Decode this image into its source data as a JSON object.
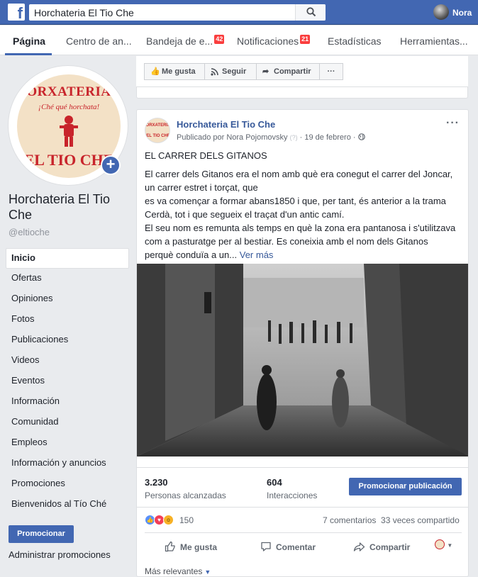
{
  "topbar": {
    "logo": "f",
    "search_value": "Horchateria El Tio Che",
    "user_name": "Nora"
  },
  "tabs": [
    {
      "label": "Página"
    },
    {
      "label": "Centro de an..."
    },
    {
      "label": "Bandeja de e...",
      "badge": "42"
    },
    {
      "label": "Notificaciones",
      "badge": "21"
    },
    {
      "label": "Estadísticas"
    },
    {
      "label": "Herramientas..."
    }
  ],
  "page": {
    "logo_top": "ORXATERIA",
    "logo_script": "¡Ché qué horchata!",
    "logo_bottom": "EL TIO CHE",
    "name": "Horchateria El Tio Che",
    "handle": "@eltioche"
  },
  "nav": [
    "Inicio",
    "Ofertas",
    "Opiniones",
    "Fotos",
    "Publicaciones",
    "Videos",
    "Eventos",
    "Información",
    "Comunidad",
    "Empleos",
    "Información y anuncios",
    "Promociones",
    "Bienvenidos al Tío Ché"
  ],
  "left_actions": {
    "promote": "Promocionar",
    "admin": "Administrar promociones"
  },
  "actionbar": {
    "like": "Me gusta",
    "follow": "Seguir",
    "share": "Compartir",
    "more": "···"
  },
  "post": {
    "author": "Horchateria El Tio Che",
    "published_by": "Publicado por Nora Pojomovsky",
    "date": "19 de febrero",
    "title": "EL CARRER DELS GITANOS",
    "body_lines": [
      "El carrer dels Gitanos era el nom amb què era conegut el carrer del Joncar,",
      "un carrer estret i torçat, que",
      "es va començar a formar abans1850 i que, per tant, és anterior a la trama",
      "Cerdà, tot i que segueix el traçat d'un antic camí.",
      "El seu nom es remunta als temps en què la zona era pantanosa i s'utilitzava",
      "com a pasturatge per al bestiar. Es coneixia amb el nom dels Gitanos",
      "perquè conduïa a un..."
    ],
    "see_more": "Ver más",
    "reached_num": "3.230",
    "reached_label": "Personas alcanzadas",
    "interactions_num": "604",
    "interactions_label": "Interacciones",
    "promote_post": "Promocionar publicación",
    "reactions_count": "150",
    "comments": "7 comentarios",
    "shares": "33 veces compartido",
    "btn_like": "Me gusta",
    "btn_comment": "Comentar",
    "btn_share": "Compartir",
    "most_relevant": "Más relevantes"
  },
  "colors": {
    "fb_blue": "#4267b2",
    "link_blue": "#365899",
    "badge_red": "#fa3e3e",
    "brand_red": "#c8242b"
  }
}
